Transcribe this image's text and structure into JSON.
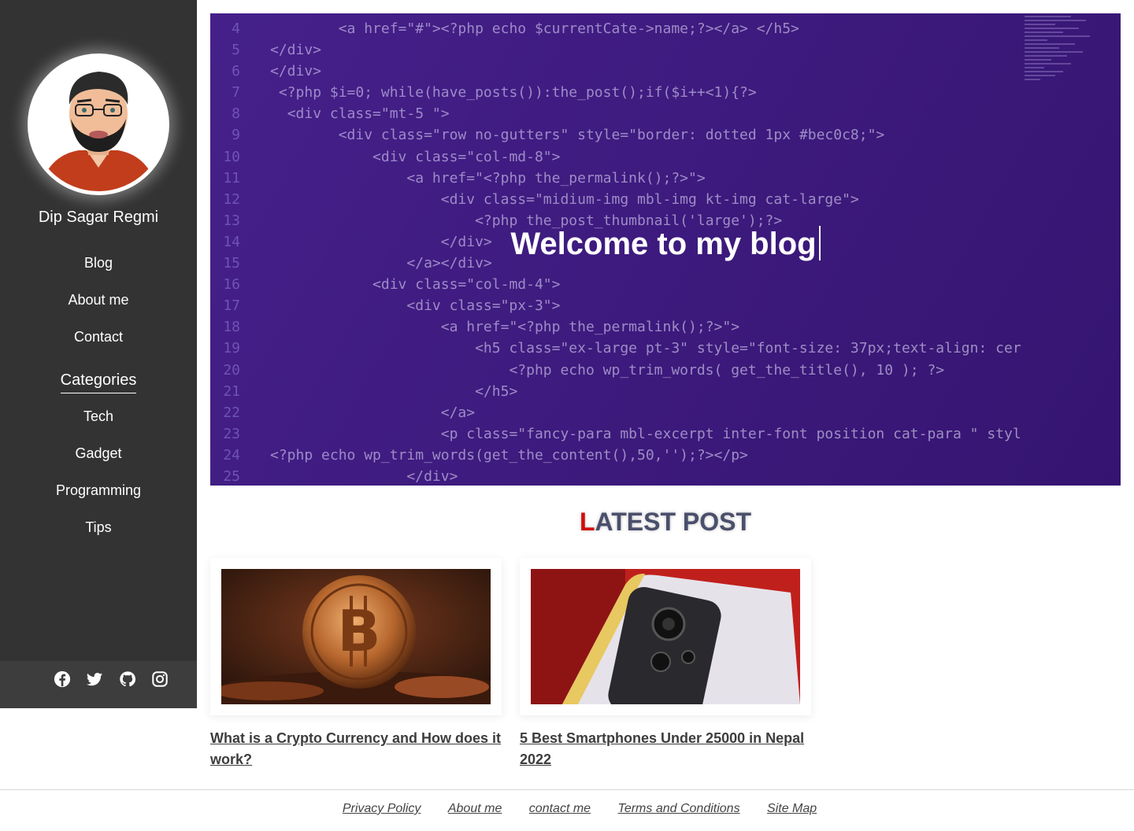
{
  "sidebar": {
    "author_name": "Dip Sagar Regmi",
    "nav": [
      {
        "label": "Blog"
      },
      {
        "label": "About me"
      },
      {
        "label": "Contact"
      }
    ],
    "categories_heading": "Categories",
    "categories": [
      {
        "label": "Tech"
      },
      {
        "label": "Gadget"
      },
      {
        "label": "Programming"
      },
      {
        "label": "Tips"
      }
    ],
    "social": [
      "facebook-icon",
      "twitter-icon",
      "github-icon",
      "instagram-icon"
    ]
  },
  "hero": {
    "title": "Welcome to my blog",
    "code_lines": [
      {
        "n": "4",
        "ind": "        ",
        "code": "<a href=\"#\"><?php echo $currentCate->name;?></a> </h5>"
      },
      {
        "n": "5",
        "ind": "",
        "code": "</div>"
      },
      {
        "n": "6",
        "ind": "",
        "code": "</div>"
      },
      {
        "n": "7",
        "ind": " ",
        "code": "<?php $i=0; while(have_posts()):the_post();if($i++<1){?>"
      },
      {
        "n": "8",
        "ind": "  ",
        "code": "<div class=\"mt-5 \">"
      },
      {
        "n": "9",
        "ind": "        ",
        "code": "<div class=\"row no-gutters\" style=\"border: dotted 1px #bec0c8;\">"
      },
      {
        "n": "10",
        "ind": "            ",
        "code": "<div class=\"col-md-8\">"
      },
      {
        "n": "11",
        "ind": "                ",
        "code": "<a href=\"<?php the_permalink();?>\">"
      },
      {
        "n": "12",
        "ind": "                    ",
        "code": "<div class=\"midium-img mbl-img kt-img cat-large\">"
      },
      {
        "n": "13",
        "ind": "                        ",
        "code": "<?php the_post_thumbnail('large');?>"
      },
      {
        "n": "14",
        "ind": "                    ",
        "code": "</div>"
      },
      {
        "n": "15",
        "ind": "                ",
        "code": "</a></div>"
      },
      {
        "n": "16",
        "ind": "            ",
        "code": "<div class=\"col-md-4\">"
      },
      {
        "n": "17",
        "ind": "                ",
        "code": "<div class=\"px-3\">"
      },
      {
        "n": "18",
        "ind": "                    ",
        "code": "<a href=\"<?php the_permalink();?>\">"
      },
      {
        "n": "19",
        "ind": "                        ",
        "code": "<h5 class=\"ex-large pt-3\" style=\"font-size: 37px;text-align: cer"
      },
      {
        "n": "20",
        "ind": "                            ",
        "code": "<?php echo wp_trim_words( get_the_title(), 10 ); ?>"
      },
      {
        "n": "21",
        "ind": "                        ",
        "code": "</h5>"
      },
      {
        "n": "22",
        "ind": "                    ",
        "code": "</a>"
      },
      {
        "n": "23",
        "ind": "                    ",
        "code": "<p class=\"fancy-para mbl-excerpt inter-font position cat-para \" styl"
      },
      {
        "n": "24",
        "ind": "",
        "code": "<?php echo wp_trim_words(get_the_content(),50,'');?></p>"
      },
      {
        "n": "25",
        "ind": "                ",
        "code": "</div>"
      }
    ]
  },
  "latest": {
    "first_letter": "L",
    "rest": "ATEST POST"
  },
  "posts": [
    {
      "title": "What is a Crypto Currency and How does it work?",
      "image": "bitcoin-coin-image"
    },
    {
      "title": "5 Best Smartphones Under 25000 in Nepal 2022",
      "image": "smartphone-camera-image"
    }
  ],
  "footer": {
    "links": [
      "Privacy Policy",
      "About me",
      "contact me",
      "Terms and Conditions",
      "Site Map"
    ]
  },
  "colors": {
    "sidebar_bg": "#333333",
    "hero_bg": "#3c1a78",
    "accent_red": "#d20c0c"
  }
}
